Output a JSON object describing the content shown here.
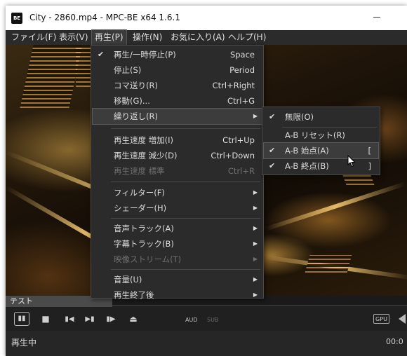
{
  "window": {
    "title": "City - 2860.mp4 - MPC-BE x64 1.6.1",
    "icon_text": "BE"
  },
  "menubar": {
    "items": [
      {
        "label": "ファイル(F)"
      },
      {
        "label": "表示(V)"
      },
      {
        "label": "再生(P)",
        "active": true
      },
      {
        "label": "操作(N)"
      },
      {
        "label": "お気に入り(A)"
      },
      {
        "label": "ヘルプ(H)"
      }
    ]
  },
  "play_menu": {
    "items": [
      {
        "label": "再生/一時停止(P)",
        "shortcut": "Space",
        "checked": true
      },
      {
        "label": "停止(S)",
        "shortcut": "Period"
      },
      {
        "label": "コマ送り(R)",
        "shortcut": "Ctrl+Right"
      },
      {
        "label": "移動(G)...",
        "shortcut": "Ctrl+G"
      },
      {
        "label": "繰り返し(R)",
        "submenu": true,
        "highlighted": true
      },
      {
        "label": "再生速度 増加(I)",
        "shortcut": "Ctrl+Up"
      },
      {
        "label": "再生速度 減少(D)",
        "shortcut": "Ctrl+Down"
      },
      {
        "label": "再生速度 標準",
        "shortcut": "Ctrl+R",
        "disabled": true
      },
      {
        "label": "フィルター(F)",
        "submenu": true
      },
      {
        "label": "シェーダー(H)",
        "submenu": true
      },
      {
        "label": "音声トラック(A)",
        "submenu": true
      },
      {
        "label": "字幕トラック(B)",
        "submenu": true
      },
      {
        "label": "映像ストリーム(T)",
        "submenu": true,
        "disabled": true
      },
      {
        "label": "音量(U)",
        "submenu": true
      },
      {
        "label": "再生終了後",
        "submenu": true
      }
    ]
  },
  "repeat_submenu": {
    "items": [
      {
        "label": "無限(O)",
        "checked": true
      },
      {
        "label": "A-B リセット(R)"
      },
      {
        "label": "A-B 始点(A)",
        "shortcut": "[",
        "checked": true,
        "highlighted": true
      },
      {
        "label": "A-B 終点(B)",
        "shortcut": "]",
        "checked": true
      }
    ]
  },
  "seekbar": {
    "label": "テスト"
  },
  "controls": {
    "pause_icon": "pause-icon",
    "aud_label": "AUD",
    "sub_label": "SUB",
    "gpu_label": "GPU"
  },
  "status": {
    "text": "再生中",
    "time": "00:0"
  },
  "colors": {
    "menu_bg": "#2b2b2b",
    "highlight": "#3c3c3c",
    "disabled_text": "#707070"
  }
}
